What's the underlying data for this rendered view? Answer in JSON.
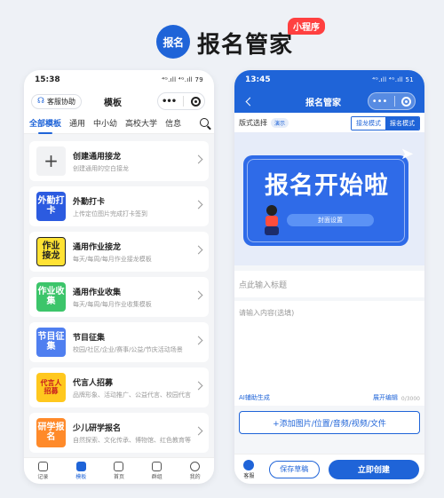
{
  "brand": {
    "logo_text": "报名",
    "title": "报名管家",
    "badge": "小程序",
    "brand_color": "#1f64d8",
    "badge_color": "#ff4040"
  },
  "left_phone": {
    "status": {
      "time": "15:38",
      "icons": "⁴ᴳ.ıll ⁴ᴳ.ıll 79"
    },
    "nav": {
      "help_label": "客服协助",
      "title": "模板"
    },
    "tabs": [
      "全部模板",
      "通用",
      "中小幼",
      "高校大学",
      "信息"
    ],
    "active_tab": "全部模板",
    "templates": [
      {
        "icon": "+",
        "title": "创建通用接龙",
        "desc": "创建通用的空白接龙",
        "icon_bg": "#f1f2f4",
        "icon_fg": "#444"
      },
      {
        "icon": "外勤打卡",
        "title": "外勤打卡",
        "desc": "上传定位图片完成打卡签到",
        "icon_bg": "#2c5be0",
        "icon_fg": "#ffffff"
      },
      {
        "icon": "作业接龙",
        "title": "通用作业接龙",
        "desc": "每天/每周/每月作业接龙模板",
        "icon_bg": "#ffe234",
        "icon_fg": "#222222"
      },
      {
        "icon": "作业收集",
        "title": "通用作业收集",
        "desc": "每天/每周/每月作业收集模板",
        "icon_bg": "#3cc56a",
        "icon_fg": "#ffffff"
      },
      {
        "icon": "节目征集",
        "title": "节目征集",
        "desc": "校园/社区/企业/赛事/公益/节庆活动场景",
        "icon_bg": "#4f7ff0",
        "icon_fg": "#ffffff"
      },
      {
        "icon": "代言人招募",
        "title": "代言人招募",
        "desc": "品牌形象、活动推广、公益代言、校园代言",
        "icon_bg": "#ffc81e",
        "icon_fg": "#c81e1e"
      },
      {
        "icon": "研学报名",
        "title": "少儿研学报名",
        "desc": "自然探索、文化传承、博物馆、红色教育等",
        "icon_bg": "#ff8a2a",
        "icon_fg": "#ffffff"
      }
    ],
    "tabbar": [
      {
        "label": "记录",
        "icon": "record-icon"
      },
      {
        "label": "模板",
        "icon": "template-icon",
        "active": true
      },
      {
        "label": "首页",
        "icon": "home-icon"
      },
      {
        "label": "群组",
        "icon": "group-icon"
      },
      {
        "label": "我的",
        "icon": "profile-icon"
      }
    ]
  },
  "right_phone": {
    "status": {
      "time": "13:45",
      "icons": "⁴ᴳ.ıll ⁴ᴳ.ıll 51"
    },
    "nav": {
      "title": "报名管家"
    },
    "layout": {
      "label": "版式选择",
      "demo": "演示",
      "mode_solitaire": "接龙模式",
      "mode_signup": "报名模式",
      "active_mode": "报名模式"
    },
    "cover": {
      "title": "报名开始啦",
      "button": "封面设置"
    },
    "title_placeholder": "点此输入标题",
    "content_placeholder": "请输入内容(选填)",
    "ai_label": "AI辅助生成",
    "expand_label": "展开编辑",
    "counter": "0/3000",
    "add_media": "+添加图片/位置/音频/视频/文件",
    "bottom": {
      "service": "客服",
      "save": "保存草稿",
      "create": "立即创建"
    }
  }
}
